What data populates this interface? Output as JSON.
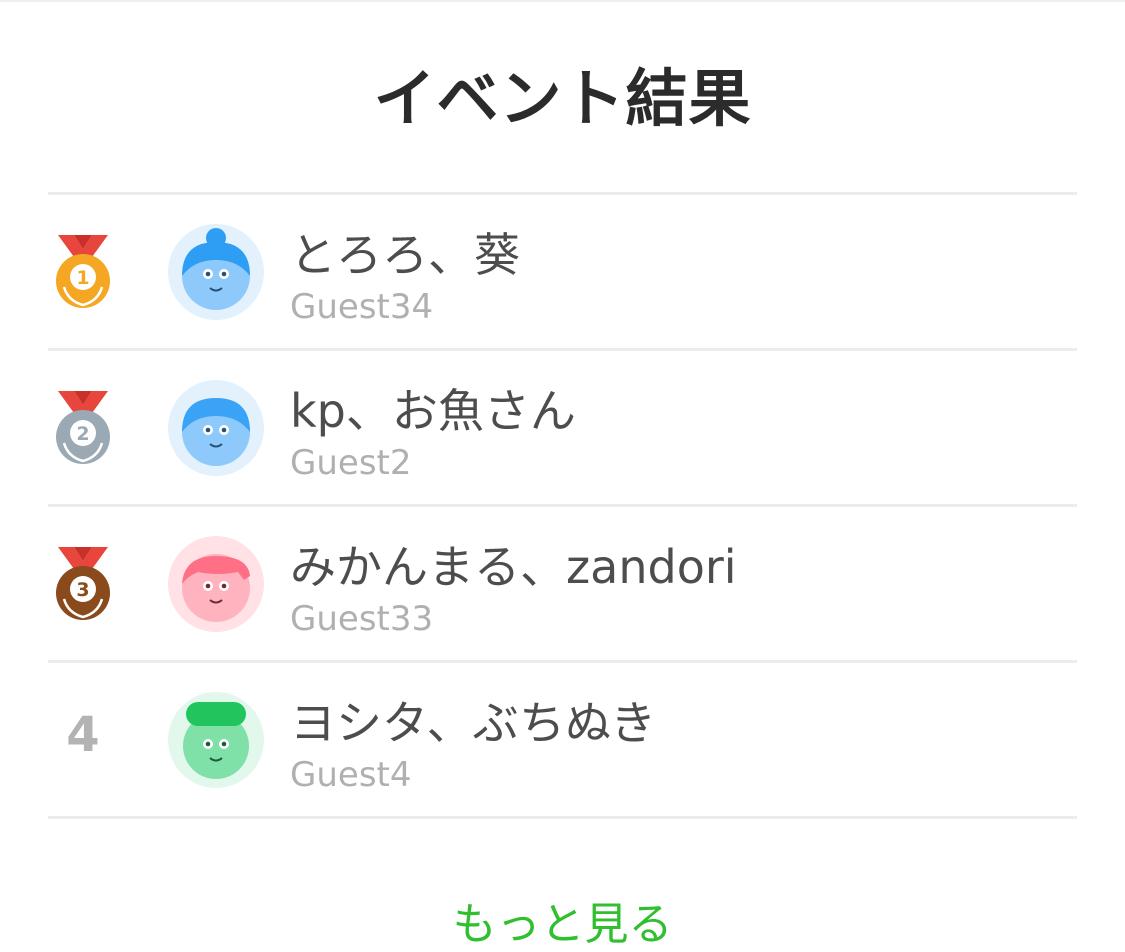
{
  "header": {
    "title": "イベント結果"
  },
  "results": [
    {
      "rank": "1",
      "medal": "gold-medal-icon",
      "avatar": "blue-bun-avatar-icon",
      "names": "とろろ、葵",
      "guest": "Guest34"
    },
    {
      "rank": "2",
      "medal": "silver-medal-icon",
      "avatar": "blue-avatar-icon",
      "names": "kp、お魚さん",
      "guest": "Guest2"
    },
    {
      "rank": "3",
      "medal": "bronze-medal-icon",
      "avatar": "pink-avatar-icon",
      "names": "みかんまる、zandori",
      "guest": "Guest33"
    },
    {
      "rank": "4",
      "medal": "",
      "avatar": "green-hat-avatar-icon",
      "names": "ヨシタ、ぶちぬき",
      "guest": "Guest4"
    }
  ],
  "footer": {
    "more_label": "もっと見る"
  },
  "colors": {
    "gold": "#f5a623",
    "silver": "#9aa9b3",
    "bronze": "#8a4a1c",
    "ribbon": "#e8453c",
    "link": "#2fbf2f"
  }
}
